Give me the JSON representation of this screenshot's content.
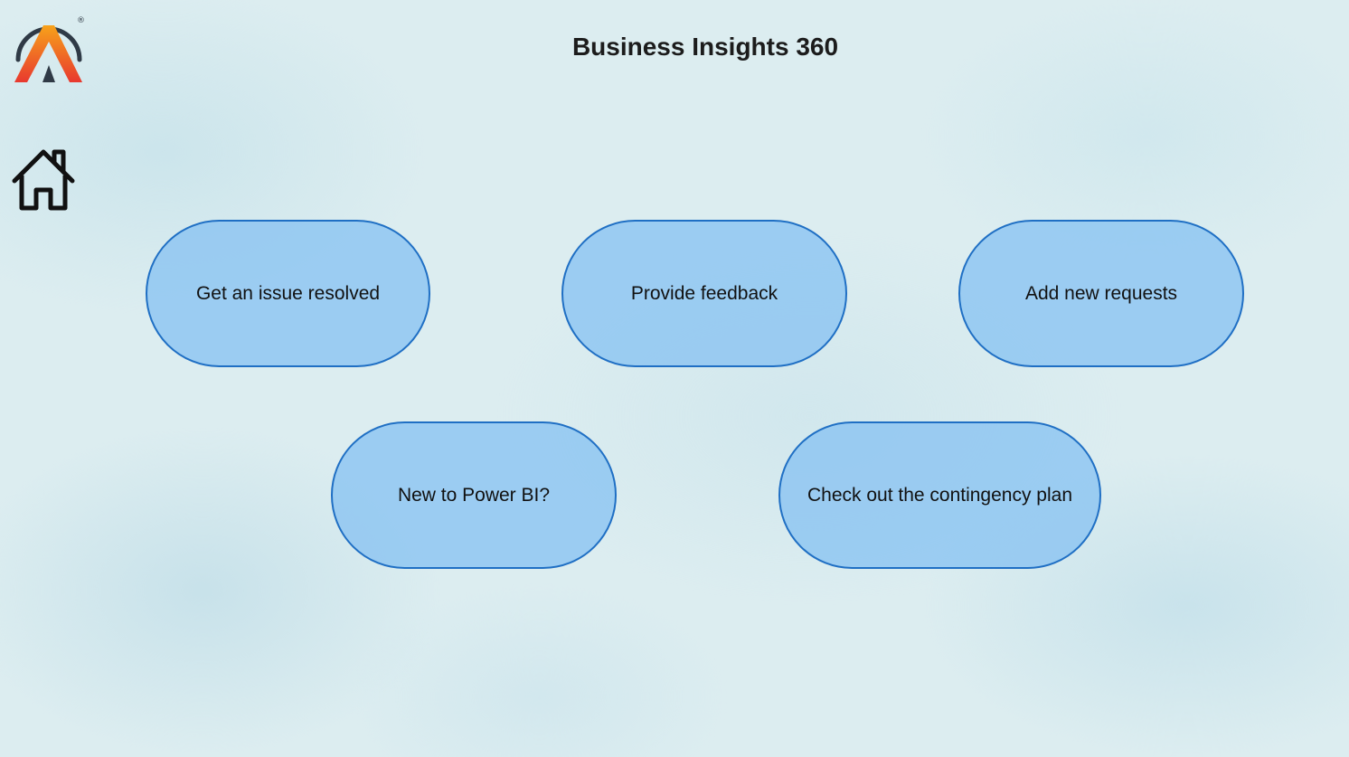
{
  "header": {
    "title": "Business Insights 360"
  },
  "logo": {
    "icon": "atliq-a-logo-icon",
    "registered_mark": "®",
    "colors": {
      "ring": "#2f3a46",
      "gradient_top": "#f7a21a",
      "gradient_bottom": "#e8392f",
      "inner": "#2f3a46"
    }
  },
  "nav": {
    "home_icon": "home-icon"
  },
  "actions": [
    {
      "label": "Get an issue resolved"
    },
    {
      "label": "Provide feedback"
    },
    {
      "label": "Add new requests"
    },
    {
      "label": "New to Power BI?"
    },
    {
      "label": "Check out the contingency plan"
    }
  ],
  "colors": {
    "button_fill": "#8cc4f2",
    "button_border": "#1f6fc4",
    "background": "#dcedf0",
    "title_text": "#1c1c1c"
  }
}
